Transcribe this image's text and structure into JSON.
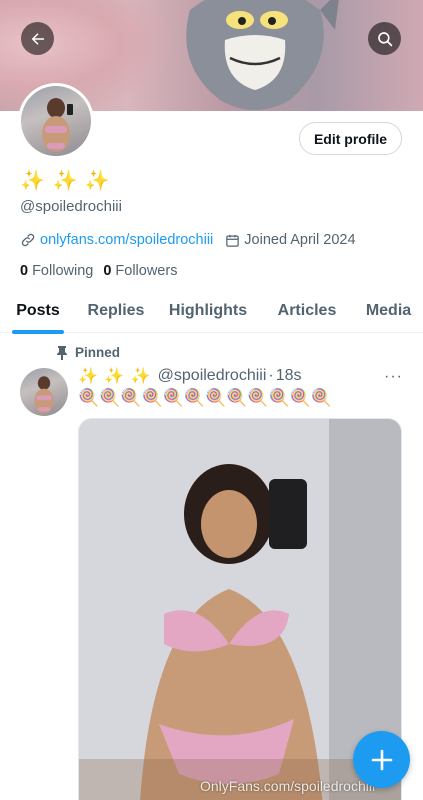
{
  "header": {
    "back_icon": "arrow-left-icon",
    "search_icon": "search-icon"
  },
  "profile": {
    "display_name": "✨ ✨ ✨",
    "handle": "@spoiledrochiii",
    "website": "onlyfans.com/spoiledrochiii",
    "joined": "Joined April 2024",
    "following_count": "0",
    "following_label": "Following",
    "followers_count": "0",
    "followers_label": "Followers",
    "edit_button": "Edit profile"
  },
  "tabs": [
    {
      "label": "Posts",
      "active": true
    },
    {
      "label": "Replies",
      "active": false
    },
    {
      "label": "Highlights",
      "active": false
    },
    {
      "label": "Articles",
      "active": false
    },
    {
      "label": "Media",
      "active": false
    }
  ],
  "post": {
    "pinned_label": "Pinned",
    "author_name": "✨ ✨ ✨",
    "author_handle": "@spoiledrochiii",
    "separator": "·",
    "time": "18s",
    "more": "···",
    "text": "🍭🍭🍭🍭🍭🍭🍭🍭🍭🍭🍭🍭",
    "watermark": "OnlyFans.com/spoiledrochiii"
  },
  "colors": {
    "accent": "#1d9bf0",
    "text_primary": "#0f1419",
    "text_secondary": "#536471"
  }
}
